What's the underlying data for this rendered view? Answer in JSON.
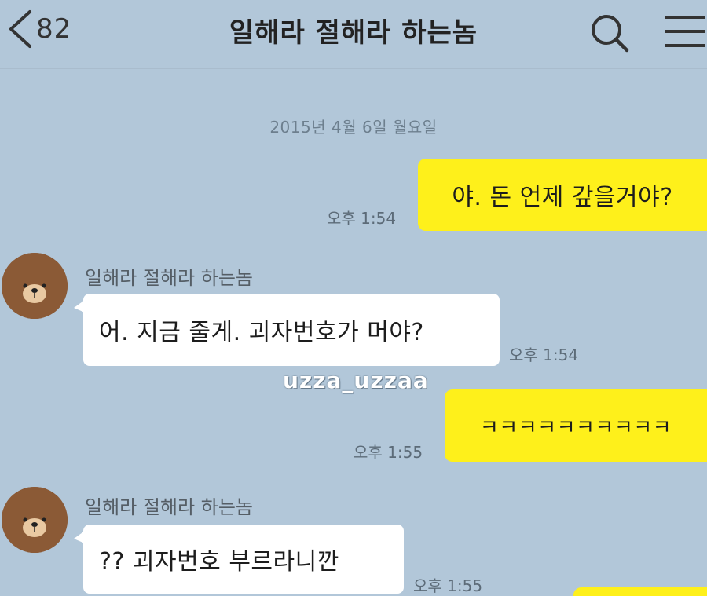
{
  "header": {
    "unread_count": "82",
    "title": "일해라 절해라 하는놈"
  },
  "date_divider": "2015년 4월 6일 월요일",
  "messages": [
    {
      "text": "야. 돈 언제 갚을거야?",
      "time": "오후 1:54"
    },
    {
      "sender": "일해라 절해라 하는놈",
      "text": "어. 지금 줄게. 괴자번호가 머야?",
      "time": "오후 1:54"
    },
    {
      "text": "ㅋㅋㅋㅋㅋㅋㅋㅋㅋㅋ",
      "time": "오후 1:55"
    },
    {
      "sender": "일해라 절해라 하는놈",
      "text": "?? 괴자번호 부르라니깐",
      "time": "오후 1:55"
    }
  ],
  "watermark": "uzza_uzzaa",
  "colors": {
    "background": "#b2c7d9",
    "my_bubble": "#fef01b",
    "their_bubble": "#ffffff",
    "avatar": "#8b5a36"
  },
  "icons": [
    "back-chevron-icon",
    "search-icon",
    "menu-icon",
    "bear-avatar-icon"
  ]
}
